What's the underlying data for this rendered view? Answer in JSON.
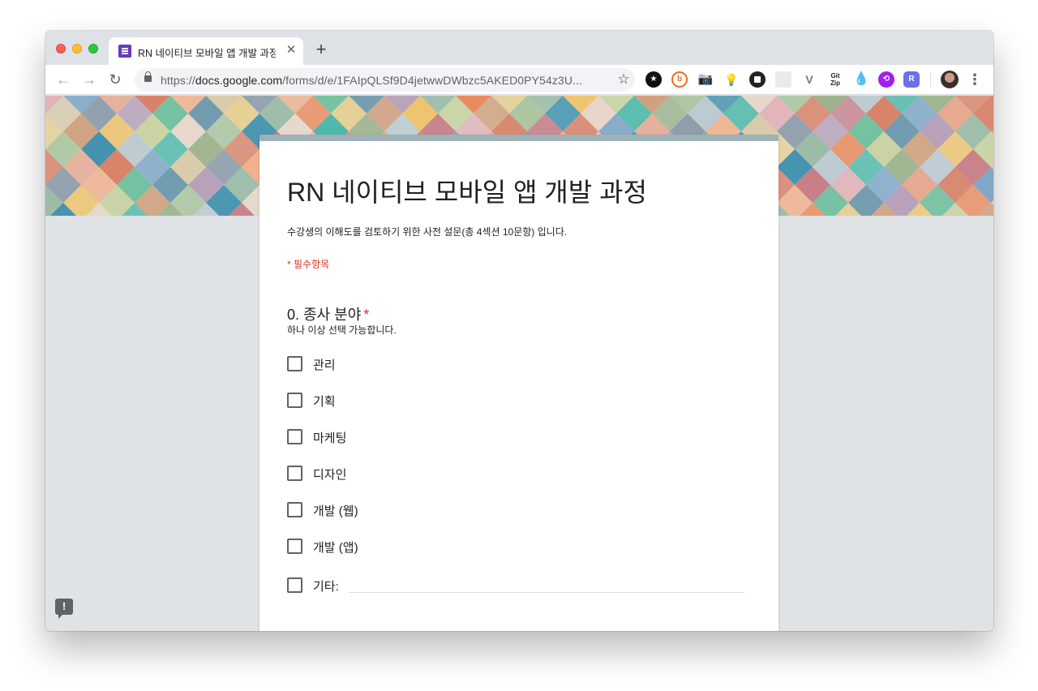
{
  "browser": {
    "tab": {
      "title": "RN 네이티브 모바일 앱 개발 과정",
      "favicon": "google-forms-icon"
    },
    "url": {
      "scheme": "https://",
      "host": "docs.google.com",
      "path": "/forms/d/e/1FAIpQLSf9D4jetwwDWbzc5AKED0PY54z3U..."
    },
    "icons": {
      "back": "←",
      "forward": "→",
      "reload": "↻",
      "star": "☆",
      "close": "✕",
      "new_tab": "+",
      "menu": "⋮"
    },
    "extensions": {
      "ext1": "★",
      "ext2": "b",
      "ext3": "📷",
      "ext4": "💡",
      "ext7": "V",
      "ext8": "Git Zip",
      "ext9": "💧",
      "ext10": "⟲",
      "ext11": "R"
    }
  },
  "form": {
    "title": "RN 네이티브 모바일 앱 개발 과정",
    "description": "수강생의 이해도를 검토하기 위한 사전 설문(총 4섹션 10문항) 입니다.",
    "required_note": "* 필수항목",
    "question": {
      "title": "0. 종사 분야",
      "required_mark": "*",
      "help": "하나 이상 선택 가능합니다.",
      "options": [
        "관리",
        "기획",
        "마케팅",
        "디자인",
        "개발 (웹)",
        "개발 (앱)",
        "기타:"
      ],
      "other_value": ""
    }
  },
  "feedback": {
    "label": "!"
  },
  "colors": {
    "accent": "#9eb1b7",
    "required": "#d93025",
    "page_bg": "#dfe3e6",
    "favicon": "#673ab7"
  }
}
